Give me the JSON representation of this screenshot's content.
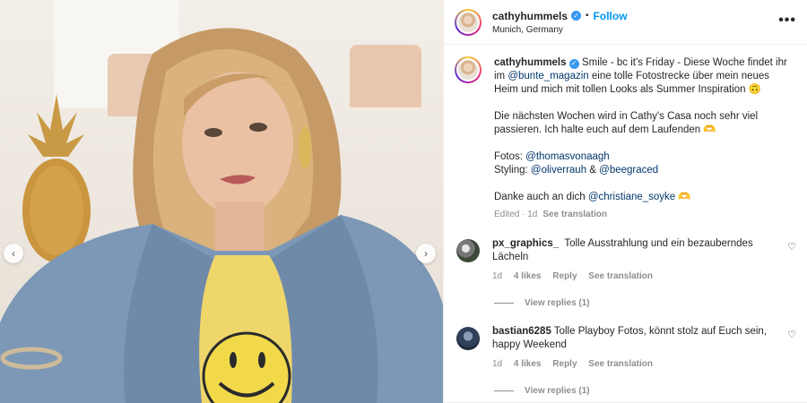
{
  "post": {
    "username": "cathyhummels",
    "follow_label": "Follow",
    "location": "Munich, Germany",
    "more_label": "•••"
  },
  "caption": {
    "username": "cathyhummels",
    "line1_pre": "Smile - bc it's Friday - Diese Woche findet ihr im ",
    "mention_bunte": "@bunte_magazin",
    "line1_post": " eine tolle Fotostrecke über mein neues Heim und mich mit tollen Looks als Summer Inspiration 🙃",
    "para2": "Die nächsten Wochen wird in Cathy's Casa noch sehr viel passieren. Ich halte euch auf dem Laufenden 🫶",
    "fotos_label": "Fotos: ",
    "fotos_mention": "@thomasvonaagh",
    "styling_label": "Styling: ",
    "styling_mention1": "@oliverrauh",
    "styling_and": " & ",
    "styling_mention2": "@beegraced",
    "thanks_pre": "Danke auch an dich ",
    "thanks_mention": "@christiane_soyke",
    "thanks_emoji": " 🫶",
    "edited": "Edited · 1d",
    "see_translation": "See translation"
  },
  "comments": [
    {
      "username": "px_graphics_",
      "text": "Tolle Ausstrahlung und ein bezauberndes Lächeln",
      "time": "1d",
      "likes": "4 likes",
      "reply": "Reply",
      "see_translation": "See translation",
      "view_replies": "View replies (1)"
    },
    {
      "username": "bastian6285",
      "text": "Tolle Playboy Fotos, könnt stolz auf Euch sein, happy Weekend",
      "time": "1d",
      "likes": "4 likes",
      "reply": "Reply",
      "see_translation": "See translation",
      "view_replies": "View replies (1)"
    }
  ],
  "colors": {
    "link": "#00376b",
    "follow": "#0095f6",
    "verified": "#3897f0",
    "muted": "#8e8e8e"
  },
  "icons": {
    "verified": "verified-badge-icon",
    "more": "more-options-icon",
    "heart": "heart-icon",
    "prev": "chevron-left-icon",
    "next": "chevron-right-icon"
  }
}
